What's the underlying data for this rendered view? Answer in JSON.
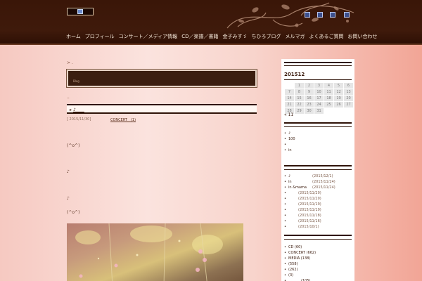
{
  "header": {
    "nav": [
      "ホーム",
      "プロフィール",
      "コンサート／メディア情報",
      "CD／楽譜／書籍",
      "金子みすゞ",
      "ちひろブログ",
      "メルマガ",
      "よくあるご質問",
      "お問い合わせ"
    ]
  },
  "main": {
    "crumb": "> .",
    "hero_label": "Blog",
    "dots": "..",
    "title_prefix": "▸",
    "title_link": "♪　　",
    "meta_date": "[ 2015/11/30]",
    "meta_category": "CONCERT　(1)",
    "paragraphs": [
      "(^o^)",
      "♪",
      "♪",
      "(^o^)"
    ]
  },
  "sidebar": {
    "calendar_title": "201512",
    "calendar_rows": [
      [
        "",
        "1",
        "2",
        "3",
        "4",
        "5",
        "6"
      ],
      [
        "7",
        "8",
        "9",
        "10",
        "11",
        "12",
        "13"
      ],
      [
        "14",
        "15",
        "16",
        "17",
        "18",
        "19",
        "20"
      ],
      [
        "21",
        "22",
        "23",
        "24",
        "25",
        "26",
        "27"
      ],
      [
        "28",
        "29",
        "30",
        "31",
        "",
        "",
        ""
      ]
    ],
    "calendar_prev": "« 11",
    "recent_a": [
      "♪",
      "100",
      "",
      "in"
    ],
    "recent_b": [
      {
        "label": "♪",
        "date": "(2015/12/1)"
      },
      {
        "label": "in",
        "date": "(2015/11/24)"
      },
      {
        "label": "in  &mama",
        "date": "(2015/11/24)"
      },
      {
        "label": "",
        "date": "(2015/11/20)"
      },
      {
        "label": "",
        "date": "(2015/11/20)"
      },
      {
        "label": "",
        "date": "(2015/11/19)"
      },
      {
        "label": "",
        "date": "(2015/11/19)"
      },
      {
        "label": "",
        "date": "(2015/11/18)"
      },
      {
        "label": "",
        "date": "(2015/11/16)"
      },
      {
        "label": "",
        "date": "(2015/10/1)"
      }
    ],
    "categories": [
      "CD (60)",
      "CONCERT (662)",
      "MEDIA (138)",
      "(558)",
      "(262)",
      "(3)",
      "(105)"
    ]
  }
}
